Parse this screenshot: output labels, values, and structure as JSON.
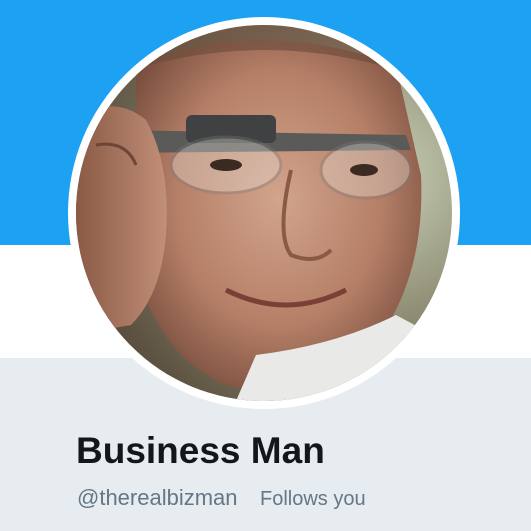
{
  "colors": {
    "banner": "#1da1f2",
    "panel": "#e6ecf0",
    "name": "#14171a",
    "secondary": "#657786"
  },
  "profile": {
    "display_name": "Business Man",
    "handle": "@therealbizman",
    "follows_you": "Follows you",
    "avatar_icon": "profile-photo"
  }
}
